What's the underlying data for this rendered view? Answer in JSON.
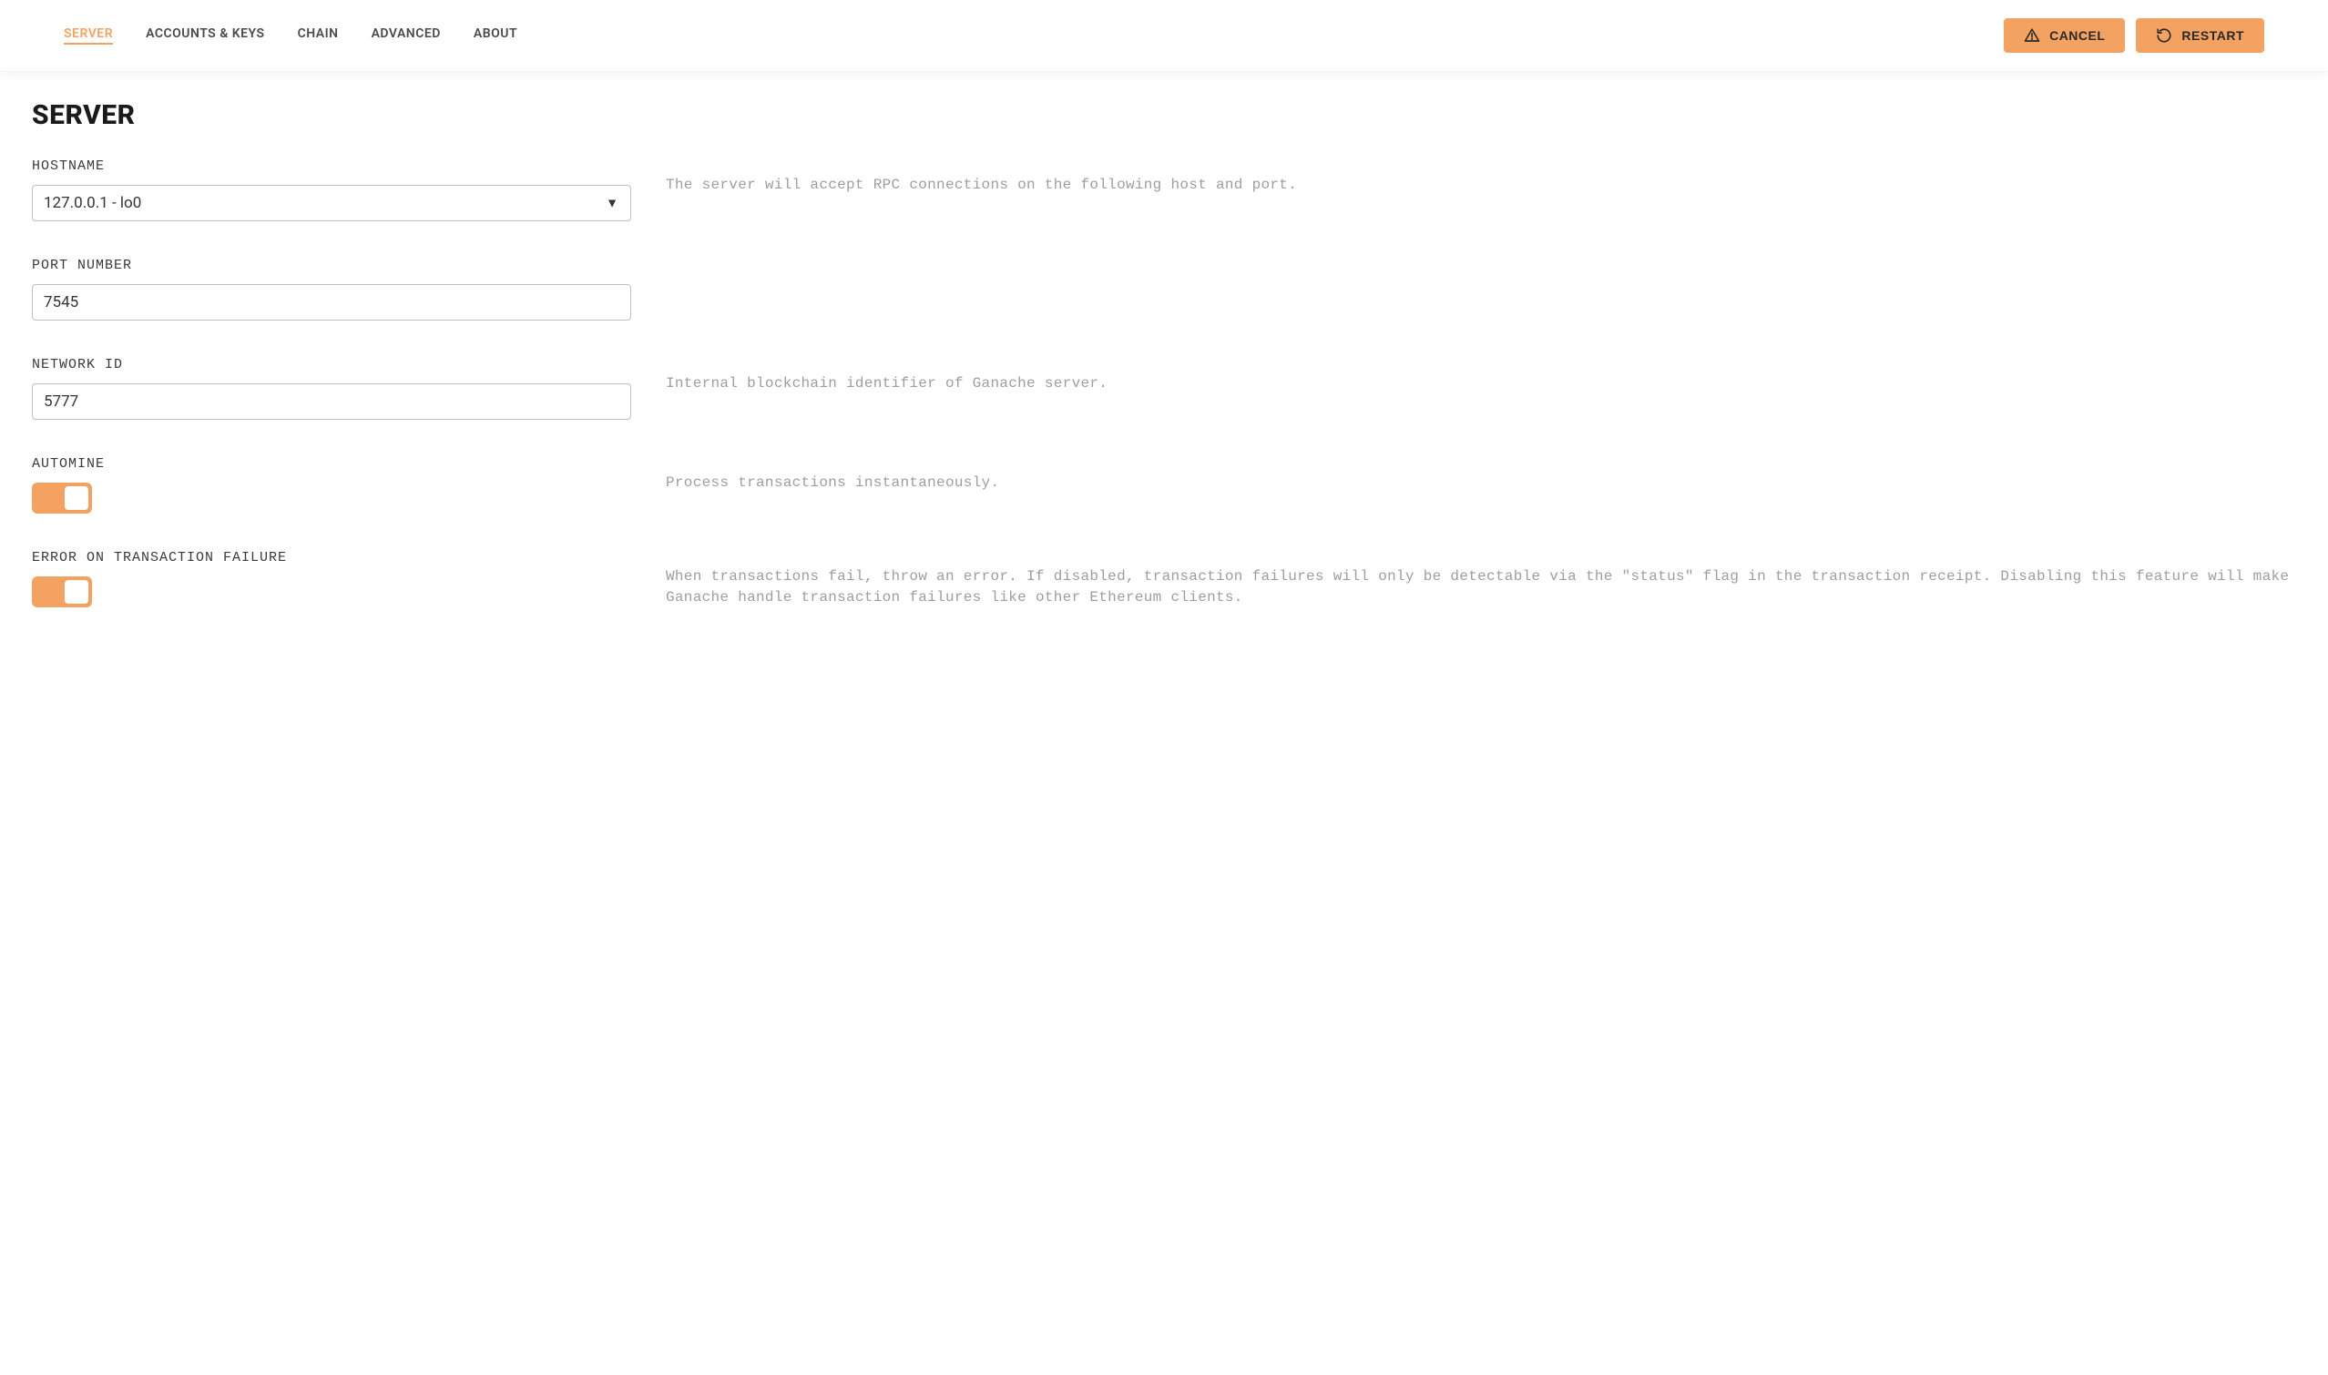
{
  "tabs": [
    {
      "label": "SERVER",
      "active": true
    },
    {
      "label": "ACCOUNTS & KEYS",
      "active": false
    },
    {
      "label": "CHAIN",
      "active": false
    },
    {
      "label": "ADVANCED",
      "active": false
    },
    {
      "label": "ABOUT",
      "active": false
    }
  ],
  "buttons": {
    "cancel": "CANCEL",
    "restart": "RESTART"
  },
  "page_title": "SERVER",
  "fields": {
    "hostname": {
      "label": "HOSTNAME",
      "value": "127.0.0.1 - lo0",
      "desc": "The server will accept RPC connections on the following host and port."
    },
    "port": {
      "label": "PORT NUMBER",
      "value": "7545",
      "desc": ""
    },
    "network_id": {
      "label": "NETWORK ID",
      "value": "5777",
      "desc": "Internal blockchain identifier of Ganache server."
    },
    "automine": {
      "label": "AUTOMINE",
      "value": true,
      "desc": "Process transactions instantaneously."
    },
    "error_on_failure": {
      "label": "ERROR ON TRANSACTION FAILURE",
      "value": true,
      "desc": "When transactions fail, throw an error. If disabled, transaction failures will only be detectable via the \"status\" flag in the transaction receipt. Disabling this feature will make Ganache handle transaction failures like other Ethereum clients."
    }
  }
}
